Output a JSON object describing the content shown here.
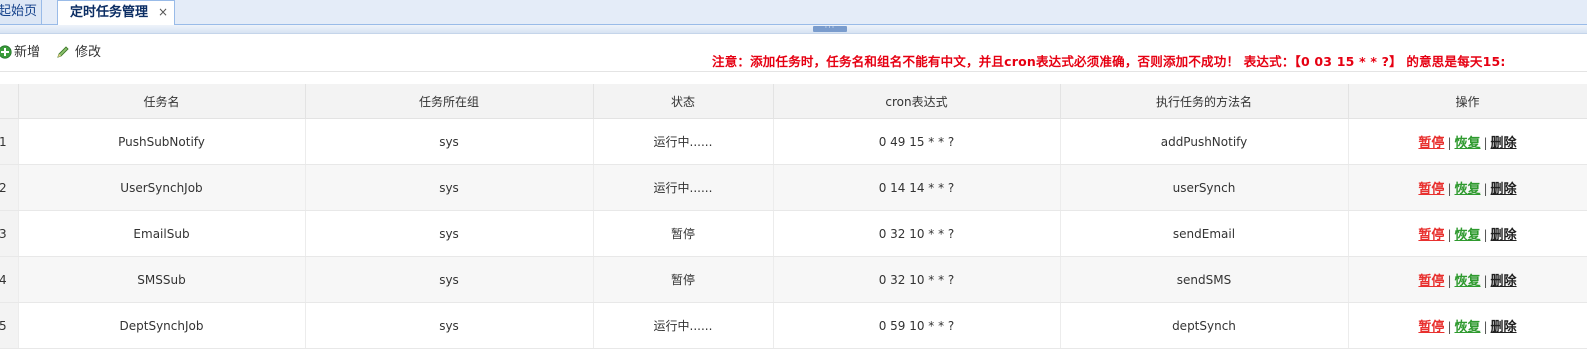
{
  "tabs": {
    "home_label": "起始页",
    "active_label": "定时任务管理",
    "close_glyph": "×"
  },
  "toolbar": {
    "add_label": "新增",
    "edit_label": "修改",
    "notice": "注意：添加任务时，任务名和组名不能有中文，并且cron表达式必须准确，否则添加不成功！ 表达式：【0 03 15 * * ?】 的意思是每天15:"
  },
  "table": {
    "headers": [
      "任务名",
      "任务所在组",
      "状态",
      "cron表达式",
      "执行任务的方法名",
      "操作"
    ],
    "rows": [
      {
        "idx": "1",
        "name": "PushSubNotify",
        "group": "sys",
        "status": "运行中......",
        "running": true,
        "cron": "0 49 15 * * ?",
        "method": "addPushNotify"
      },
      {
        "idx": "2",
        "name": "UserSynchJob",
        "group": "sys",
        "status": "运行中......",
        "running": true,
        "cron": "0 14 14 * * ?",
        "method": "userSynch"
      },
      {
        "idx": "3",
        "name": "EmailSub",
        "group": "sys",
        "status": "暂停",
        "running": false,
        "cron": "0 32 10 * * ?",
        "method": "sendEmail"
      },
      {
        "idx": "4",
        "name": "SMSSub",
        "group": "sys",
        "status": "暂停",
        "running": false,
        "cron": "0 32 10 * * ?",
        "method": "sendSMS"
      },
      {
        "idx": "5",
        "name": "DeptSynchJob",
        "group": "sys",
        "status": "运行中......",
        "running": true,
        "cron": "0 59 10 * * ?",
        "method": "deptSynch"
      }
    ],
    "actions": {
      "pause": "暂停",
      "resume": "恢复",
      "delete": "删除",
      "separator": "|"
    }
  },
  "colors": {
    "running": "#2f9a2f",
    "paused": "#e8302e",
    "notice": "#e60012",
    "tab_border": "#99bbe8"
  }
}
